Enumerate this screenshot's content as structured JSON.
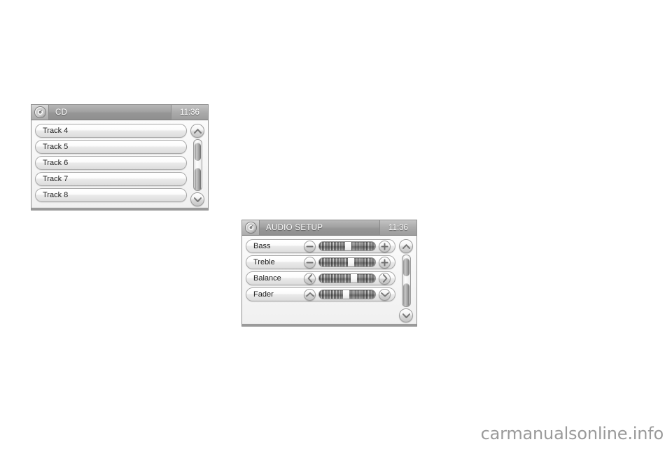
{
  "page": {
    "background": "#ffffff",
    "watermark": "carmanualsonline.info"
  },
  "figures": {
    "cd_screen": {
      "titlebar": {
        "icon": "disc-icon",
        "title": "CD",
        "clock": "11:36"
      },
      "list_items": [
        {
          "label": "Track 4"
        },
        {
          "label": "Track 5"
        },
        {
          "label": "Track 6"
        },
        {
          "label": "Track 7"
        },
        {
          "label": "Track 8"
        }
      ],
      "scrollbar": {
        "up_icon": "chevron-up-icon",
        "down_icon": "chevron-down-icon"
      }
    },
    "audio_setup_screen": {
      "titlebar": {
        "icon": "disc-icon",
        "title": "AUDIO SETUP",
        "clock": "11:36"
      },
      "settings": [
        {
          "label": "Bass",
          "decrease_icon": "minus-icon",
          "increase_icon": "plus-icon",
          "knob_percent": 52
        },
        {
          "label": "Treble",
          "decrease_icon": "minus-icon",
          "increase_icon": "plus-icon",
          "knob_percent": 57
        },
        {
          "label": "Balance",
          "decrease_icon": "chevron-left-icon",
          "increase_icon": "chevron-right-icon",
          "knob_percent": 62
        },
        {
          "label": "Fader",
          "decrease_icon": "chevron-up-icon",
          "increase_icon": "chevron-down-icon",
          "knob_percent": 48
        }
      ],
      "scrollbar": {
        "up_icon": "chevron-up-icon",
        "down_icon": "chevron-down-icon"
      }
    }
  },
  "colors": {
    "titlebar_gradient_top": "#b6b6b6",
    "titlebar_gradient_bottom": "#8f8f8f",
    "screen_background": "#f3f3f3",
    "bezel_border": "#8e8e8e",
    "text_light": "#ffffff",
    "text_dark": "#1d1d1d",
    "watermark": "#9a9a9a"
  }
}
